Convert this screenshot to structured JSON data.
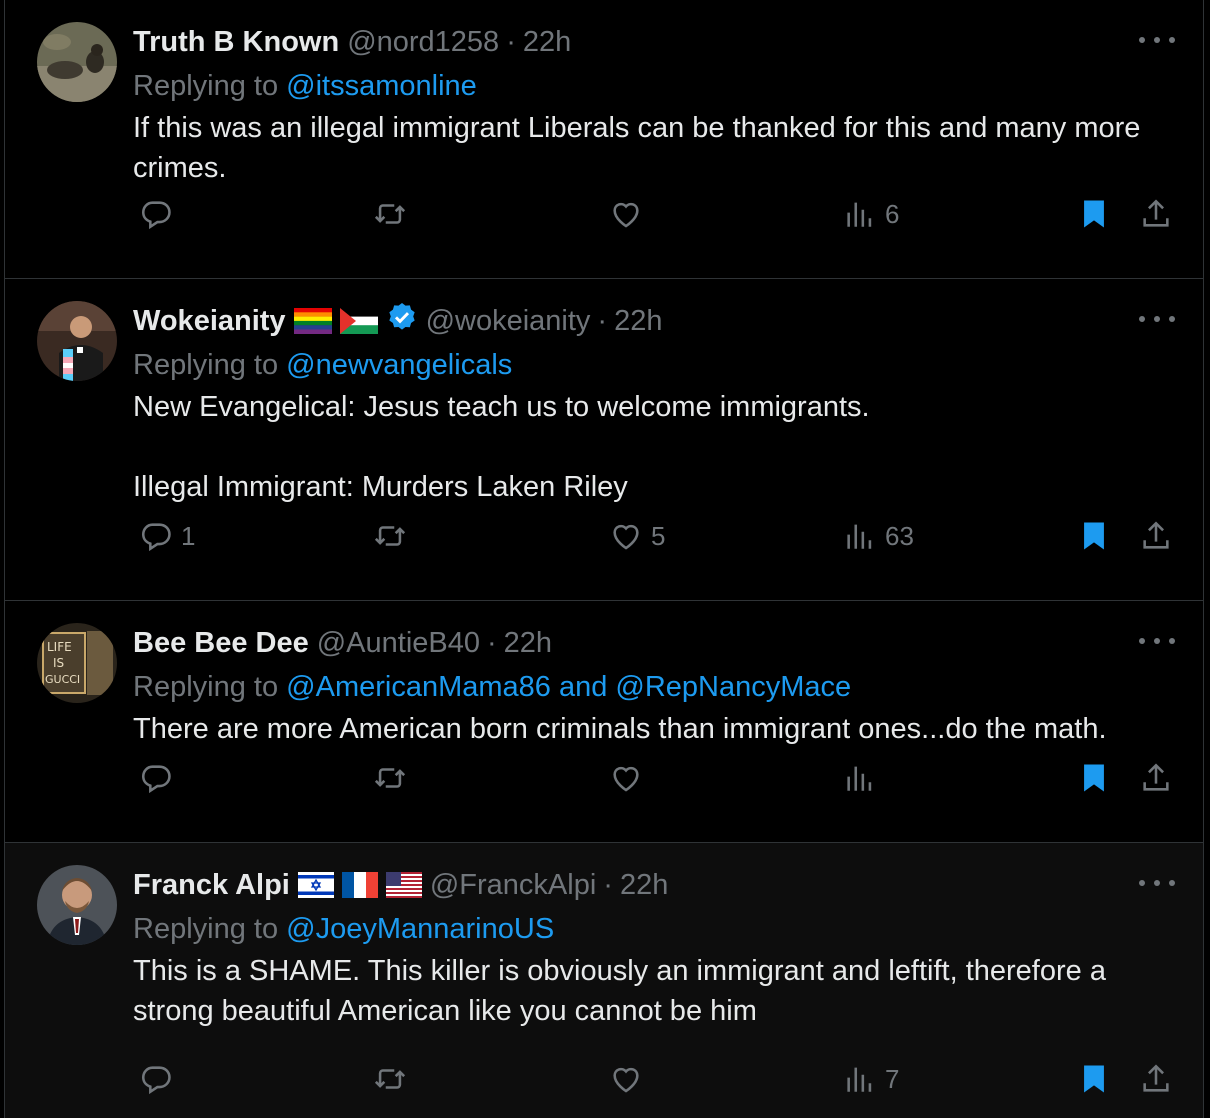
{
  "colors": {
    "background": "#000000",
    "text": "#e7e9ea",
    "muted": "#71767b",
    "accent": "#1d9bf0",
    "divider": "#2f3336"
  },
  "replying_to_label": "Replying to",
  "tweets": [
    {
      "name": "Truth B Known",
      "handle": "@nord1258",
      "time": "22h",
      "replying_to": "@itssamonline",
      "text": "If this was an illegal immigrant Liberals can be thanked for this and many more crimes.",
      "reply_count": "",
      "repost_count": "",
      "like_count": "",
      "view_count": "6",
      "bookmarked": true,
      "icons": [
        "reply-icon",
        "repost-icon",
        "like-icon",
        "views-icon",
        "bookmark-icon",
        "share-icon"
      ]
    },
    {
      "name": "Wokeianity",
      "flags": [
        "rainbow-flag",
        "palestine-flag"
      ],
      "verified": true,
      "handle": "@wokeianity",
      "time": "22h",
      "replying_to": "@newvangelicals",
      "text": "New Evangelical: Jesus teach us to welcome immigrants.\n\nIllegal Immigrant: Murders Laken Riley",
      "reply_count": "1",
      "repost_count": "",
      "like_count": "5",
      "view_count": "63",
      "bookmarked": true
    },
    {
      "name": "Bee Bee Dee",
      "handle": "@AuntieB40",
      "time": "22h",
      "replying_to": "@AmericanMama86 and @RepNancyMace",
      "text": "There are more American born criminals than immigrant ones...do the math.",
      "reply_count": "",
      "repost_count": "",
      "like_count": "",
      "view_count": "",
      "bookmarked": true
    },
    {
      "name": "Franck Alpi",
      "flags": [
        "israel-flag",
        "france-flag",
        "usa-flag"
      ],
      "handle": "@FranckAlpi",
      "time": "22h",
      "replying_to": "@JoeyMannarinoUS",
      "text": "This is a SHAME. This killer is obviously an immigrant and leftift, therefore a strong beautiful American like you cannot be him",
      "reply_count": "",
      "repost_count": "",
      "like_count": "",
      "view_count": "7",
      "bookmarked": true
    }
  ]
}
